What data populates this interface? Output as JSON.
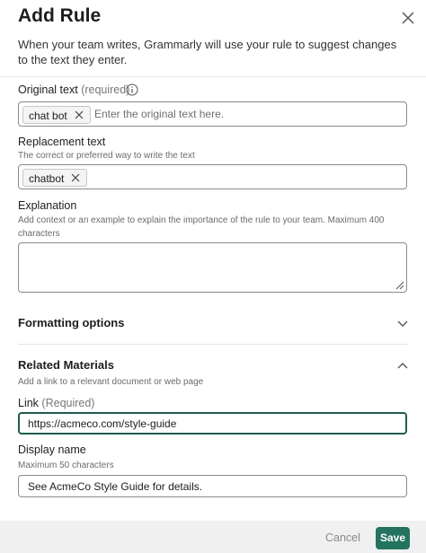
{
  "dialog": {
    "title": "Add Rule",
    "subtitle": "When your team writes, Grammarly will use your rule to suggest changes to the text they enter."
  },
  "original_text": {
    "label": "Original text",
    "qualifier": "(required)",
    "chip": "chat bot",
    "placeholder": "Enter the original text here."
  },
  "replacement_text": {
    "label": "Replacement text",
    "help": "The correct or preferred way to write the text",
    "chip": "chatbot"
  },
  "explanation": {
    "label": "Explanation",
    "help": "Add context or an example to explain the importance of the rule to your team. Maximum 400 characters",
    "value": ""
  },
  "formatting": {
    "title": "Formatting options",
    "expanded": false
  },
  "related": {
    "title": "Related Materials",
    "help": "Add a link to a relevant document or web page",
    "expanded": true
  },
  "link": {
    "label": "Link",
    "qualifier": "(Required)",
    "value": "https://acmeco.com/style-guide"
  },
  "display_name": {
    "label": "Display name",
    "help": "Maximum 50 characters",
    "value": "See AcmeCo Style Guide for details."
  },
  "footer": {
    "cancel_label": "Cancel",
    "save_label": "Save"
  },
  "colors": {
    "primary": "#24735f",
    "focus_border": "#1f5c4f"
  },
  "icons": [
    "close-icon",
    "info-icon",
    "chip-remove-icon",
    "resize-handle-icon",
    "chevron-down-icon",
    "chevron-up-icon"
  ]
}
